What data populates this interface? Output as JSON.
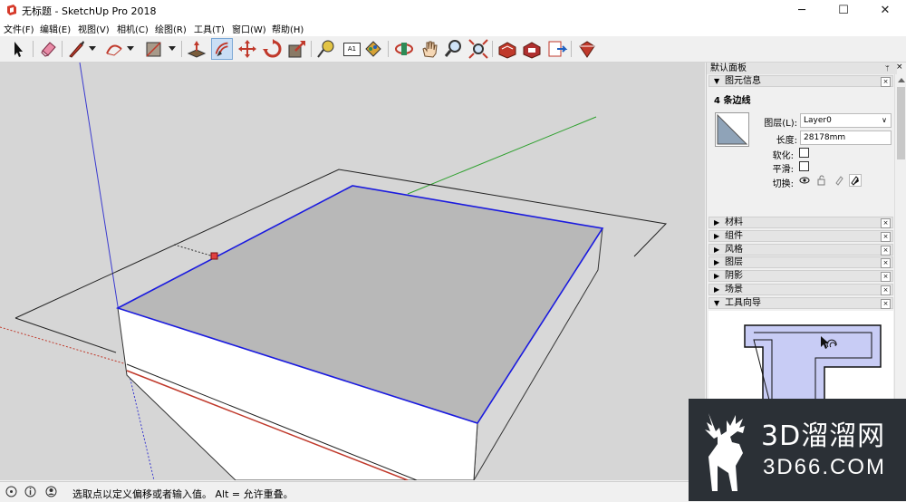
{
  "window": {
    "title": "无标题 - SketchUp Pro 2018",
    "controls": {
      "minimize": "─",
      "maximize": "☐",
      "close": "✕"
    }
  },
  "menu": [
    {
      "label": "文件(F)"
    },
    {
      "label": "编辑(E)"
    },
    {
      "label": "视图(V)"
    },
    {
      "label": "相机(C)"
    },
    {
      "label": "绘图(R)"
    },
    {
      "label": "工具(T)"
    },
    {
      "label": "窗口(W)"
    },
    {
      "label": "帮助(H)"
    }
  ],
  "toolbar": {
    "tools": [
      "select-tool",
      "eraser-tool",
      "line-tool",
      "arc-tool",
      "rectangle-tool",
      "push-pull-tool",
      "offset-tool",
      "move-tool",
      "rotate-tool",
      "scale-tool",
      "tape-measure-tool",
      "text-tool",
      "paint-bucket-tool",
      "orbit-tool",
      "pan-tool",
      "zoom-tool",
      "zoom-extents-tool",
      "3d-warehouse-tool",
      "extension-warehouse-tool",
      "layout-tool",
      "extension-manager-tool"
    ],
    "active_tool": "offset-tool",
    "text_tool_glyph": "A1"
  },
  "tray": {
    "title": "默认面板",
    "pin": "ᛘ",
    "entity_info": {
      "header": "图元信息",
      "selection_summary": "4 条边线",
      "layer_label": "图层(L):",
      "layer_value": "Layer0",
      "length_label": "长度:",
      "length_value": "28178mm",
      "soften_label": "软化:",
      "smooth_label": "平滑:",
      "toggle_label": "切换:"
    },
    "panels": [
      {
        "label": "材料"
      },
      {
        "label": "组件"
      },
      {
        "label": "风格"
      },
      {
        "label": "图层"
      },
      {
        "label": "阴影"
      },
      {
        "label": "场景"
      },
      {
        "label": "工具向导"
      }
    ],
    "close_glyph": "×",
    "collapsed_arrow": "▶",
    "expanded_arrow": "▼"
  },
  "status": {
    "text": "选取点以定义偏移或者输入值。 Alt = 允许重叠。"
  },
  "watermark": {
    "big": "3D溜溜网",
    "small": "3D66.COM"
  },
  "colors": {
    "selection_edge": "#1a1adf",
    "top_face": "#b8b8b8",
    "viewport_bg": "#d6d6d6",
    "axis_red": "#c0392b",
    "axis_green": "#2ea02e",
    "axis_blue": "#3a3acf",
    "inference_point": "#e04040"
  }
}
